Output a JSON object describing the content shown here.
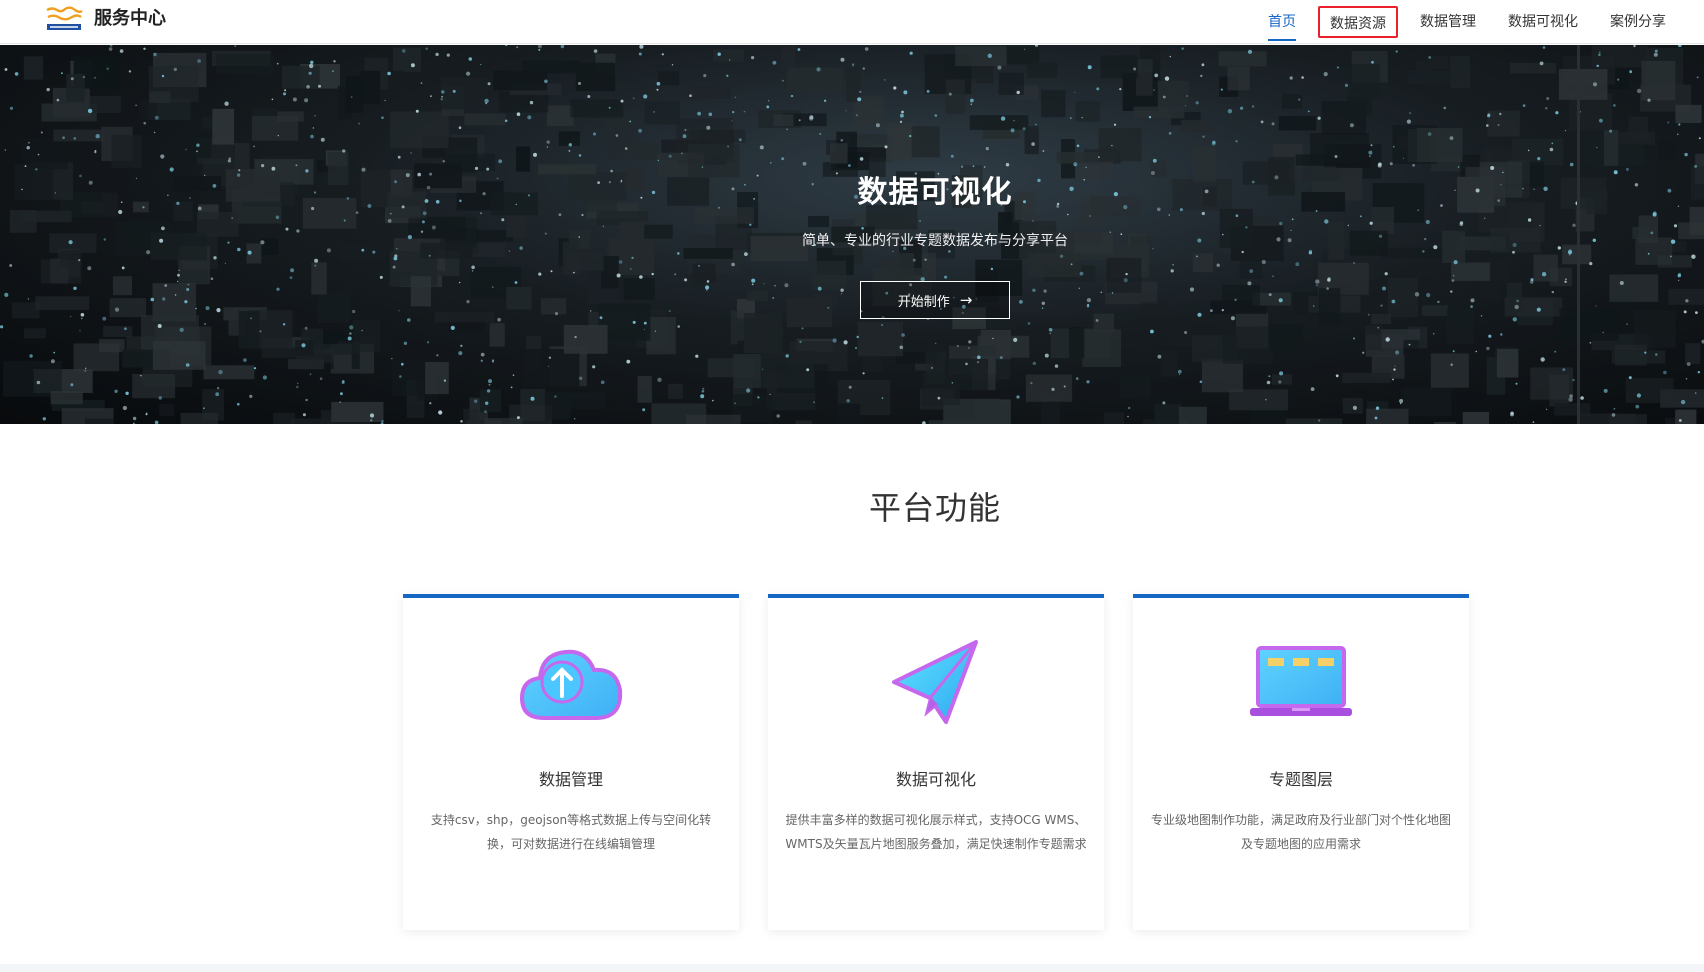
{
  "header": {
    "brand": "服务中心",
    "nav": [
      {
        "label": "首页"
      },
      {
        "label": "数据资源"
      },
      {
        "label": "数据管理"
      },
      {
        "label": "数据可视化"
      },
      {
        "label": "案例分享"
      }
    ]
  },
  "hero": {
    "title": "数据可视化",
    "subtitle": "简单、专业的行业专题数据发布与分享平台",
    "button_label": "开始制作"
  },
  "features": {
    "title": "平台功能",
    "cards": [
      {
        "title": "数据管理",
        "desc": "支持csv，shp，geojson等格式数据上传与空间化转换，可对数据进行在线编辑管理",
        "icon": "cloud-upload-icon"
      },
      {
        "title": "数据可视化",
        "desc": "提供丰富多样的数据可视化展示样式，支持OCG WMS、WMTS及矢量瓦片地图服务叠加，满足快速制作专题需求",
        "icon": "paper-plane-icon"
      },
      {
        "title": "专题图层",
        "desc": "专业级地图制作功能，满足政府及行业部门对个性化地图及专题地图的应用需求",
        "icon": "laptop-icon"
      }
    ]
  },
  "colors": {
    "accent": "#1766c4",
    "highlight_border": "#e8202a"
  }
}
